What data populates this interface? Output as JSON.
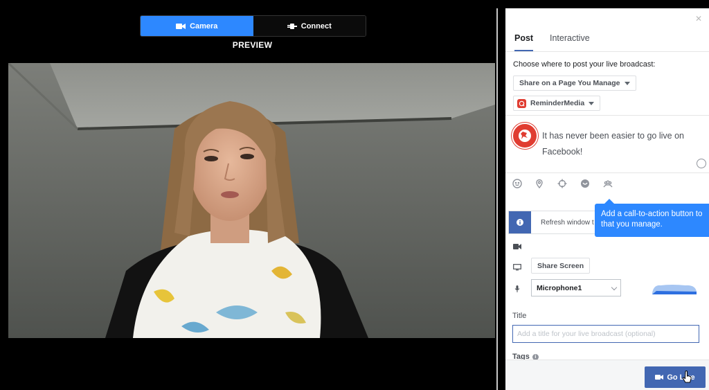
{
  "mode_toggle": {
    "camera_label": "Camera",
    "connect_label": "Connect"
  },
  "preview_label": "PREVIEW",
  "panel": {
    "close_icon": "close-icon",
    "tabs": [
      {
        "label": "Post"
      },
      {
        "label": "Interactive"
      }
    ],
    "share_prompt": "Choose where to post your live broadcast:",
    "share_dropdown": "Share on a Page You Manage",
    "page_dropdown": "ReminderMedia",
    "post_text": "It has never been easier to go live on Facebook!",
    "tool_icons": [
      "smiley-icon",
      "location-pin-icon",
      "target-icon",
      "sticker-icon",
      "people-icon"
    ],
    "info_text": "Refresh window t",
    "tooltip": {
      "line1": "Add a call-to-action button to",
      "line2": "that you manage."
    },
    "share_screen_label": "Share Screen",
    "microphone_value": "Microphone1",
    "title_label": "Title",
    "title_placeholder": "Add a title for your live broadcast (optional)",
    "tags_label": "Tags",
    "go_live_label": "Go Live"
  },
  "colors": {
    "accent": "#2d88ff",
    "facebook_blue": "#4267b2",
    "brand_red": "#e03c31"
  }
}
